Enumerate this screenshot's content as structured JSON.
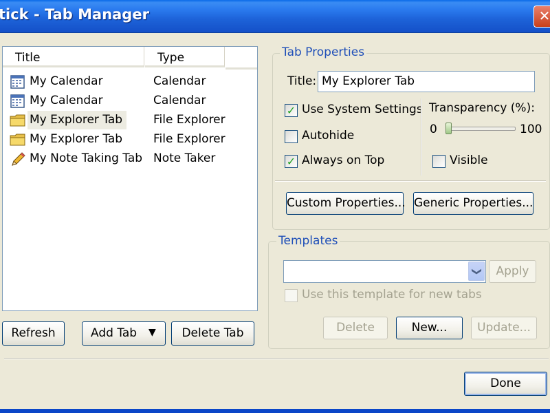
{
  "window": {
    "title": "tick - Tab Manager",
    "close_glyph": "✕"
  },
  "tab_list": {
    "columns": [
      "Title",
      "Type"
    ],
    "rows": [
      {
        "title": "My Calendar",
        "type": "Calendar",
        "icon": "calendar-icon"
      },
      {
        "title": "My Calendar",
        "type": "Calendar",
        "icon": "calendar-icon"
      },
      {
        "title": "My Explorer Tab",
        "type": "File Explorer",
        "icon": "folder-icon",
        "selected": true
      },
      {
        "title": "My Explorer Tab",
        "type": "File Explorer",
        "icon": "folder-icon"
      },
      {
        "title": "My Note Taking Tab",
        "type": "Note Taker",
        "icon": "pencil-icon"
      }
    ]
  },
  "list_buttons": {
    "refresh": "Refresh",
    "add_tab": "Add Tab",
    "add_tab_arrow": "▼",
    "delete_tab": "Delete Tab"
  },
  "tab_properties": {
    "group_label": "Tab Properties",
    "title_label": "Title:",
    "title_value": "My Explorer Tab",
    "use_system_settings": {
      "label": "Use System Settings",
      "checked": true
    },
    "autohide": {
      "label": "Autohide",
      "checked": false
    },
    "always_on_top": {
      "label": "Always on Top",
      "checked": true
    },
    "transparency_label": "Transparency (%):",
    "transparency_min": "0",
    "transparency_max": "100",
    "transparency_value": 0,
    "visible": {
      "label": "Visible",
      "checked": false
    },
    "custom_properties_button": "Custom Properties...",
    "generic_properties_button": "Generic Properties..."
  },
  "templates": {
    "group_label": "Templates",
    "selected_value": "",
    "dropdown_glyph": "❯",
    "apply_button": "Apply",
    "use_template_label": "Use this template for new tabs",
    "delete_button": "Delete",
    "new_button": "New...",
    "update_button": "Update..."
  },
  "done_button": "Done",
  "check_glyph": "✓",
  "colors": {
    "titlebar": "#1d62d8",
    "group_label": "#1f4fb8",
    "dialog_bg": "#ece9d8"
  }
}
